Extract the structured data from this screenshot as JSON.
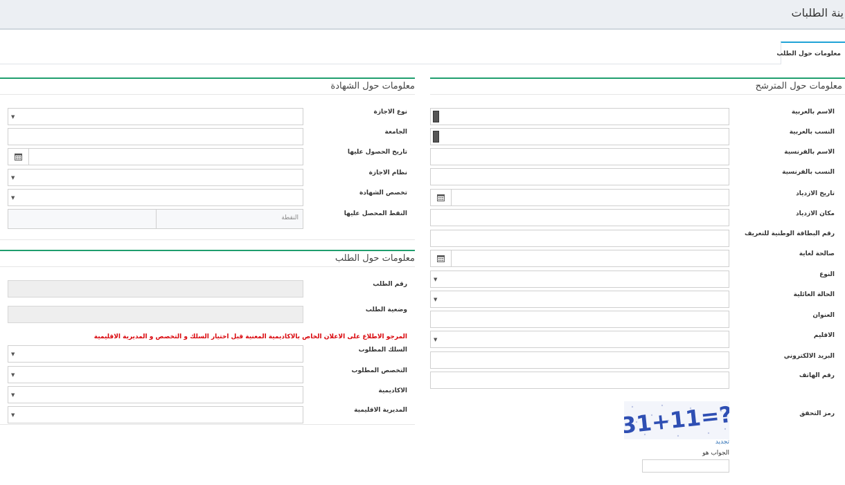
{
  "header": {
    "title": "ينة الطلبات"
  },
  "tabs": [
    {
      "label": "معلومات حول الطلب"
    }
  ],
  "candidate": {
    "title": "معلومات حول المترشح",
    "labels": {
      "name_ar": "الاسم بالعربية",
      "surname_ar": "النسب بالعربية",
      "name_fr": "الاسم بالفرنسية",
      "surname_fr": "النسب بالفرنسية",
      "birth_date": "تاريخ الازدياد",
      "birth_place": "مكان الازدياد",
      "cin": "رقم البطاقة الوطنية للتعريف",
      "valid_until": "صالحة لغاية",
      "gender": "النوع",
      "marital": "الحالة العائلية",
      "address": "العنوان",
      "region": "الاقليم",
      "email": "البريد الالكتروني",
      "phone": "رقم الهاتف",
      "captcha": "رمز التحقق"
    },
    "captcha_text": "31+11=?",
    "captcha_refresh": "تجديد",
    "captcha_answer_label": "الجواب هو"
  },
  "certificate": {
    "title": "معلومات حول الشهادة",
    "labels": {
      "degree_type": "نوع الاجازة",
      "university": "الجامعة",
      "obtained_date": "تاريخ الحصول عليها",
      "degree_system": "نظام الاجازة",
      "specialty": "تخصص الشهادة",
      "grade": "النقط المحصل عليها"
    },
    "grade_placeholder": "النقطة"
  },
  "request": {
    "title": "معلومات حول الطلب",
    "labels": {
      "number": "رقم الطلب",
      "status": "وضعية الطلب",
      "corps": "السلك المطلوب",
      "specialty": "التخصص المطلوب",
      "academy": "الاكاديمية",
      "directorate": "المديرية الاقليمية"
    },
    "notice": "المرجو الاطلاع على الاعلان الخاص بالاكاديمية المعنية قبل اختيار السلك و التخصص و المديرية الاقليمية"
  },
  "colors": {
    "accent": "#1fa2d6",
    "section_rule": "#1f9e6e",
    "notice": "#d9040a",
    "captcha_text": "#2f4fb3"
  },
  "icons": {
    "calendar": "calendar-icon",
    "dropdown": "dropdown-arrow-icon"
  }
}
